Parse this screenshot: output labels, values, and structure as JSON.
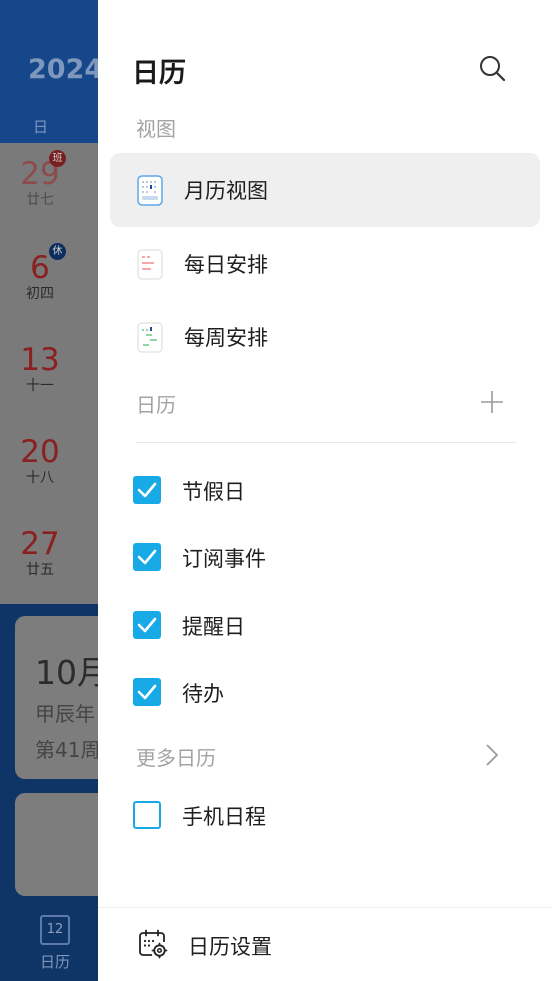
{
  "background": {
    "year_partial": "2024",
    "weekday": "日",
    "days": [
      {
        "num": "29",
        "lunar": "廿七",
        "badge": "班"
      },
      {
        "num": "6",
        "lunar": "初四",
        "badge": "休"
      },
      {
        "num": "13",
        "lunar": "十一",
        "badge": ""
      },
      {
        "num": "20",
        "lunar": "十八",
        "badge": ""
      },
      {
        "num": "27",
        "lunar": "廿五",
        "badge": ""
      }
    ],
    "card_month": "10月",
    "card_line1": "甲辰年",
    "card_line2": "第41周",
    "tab_icon_day": "12",
    "tab_label": "日历"
  },
  "drawer": {
    "title": "日历",
    "views_label": "视图",
    "views": [
      {
        "label": "月历视图",
        "active": true
      },
      {
        "label": "每日安排",
        "active": false
      },
      {
        "label": "每周安排",
        "active": false
      }
    ],
    "calendars_label": "日历",
    "calendars": [
      {
        "label": "节假日",
        "checked": true
      },
      {
        "label": "订阅事件",
        "checked": true
      },
      {
        "label": "提醒日",
        "checked": true
      },
      {
        "label": "待办",
        "checked": true
      }
    ],
    "more_label": "更多日历",
    "more_calendars": [
      {
        "label": "手机日程",
        "checked": false
      }
    ],
    "settings_label": "日历设置"
  },
  "colors": {
    "accent": "#17aae6",
    "active_bg": "#efefef"
  }
}
